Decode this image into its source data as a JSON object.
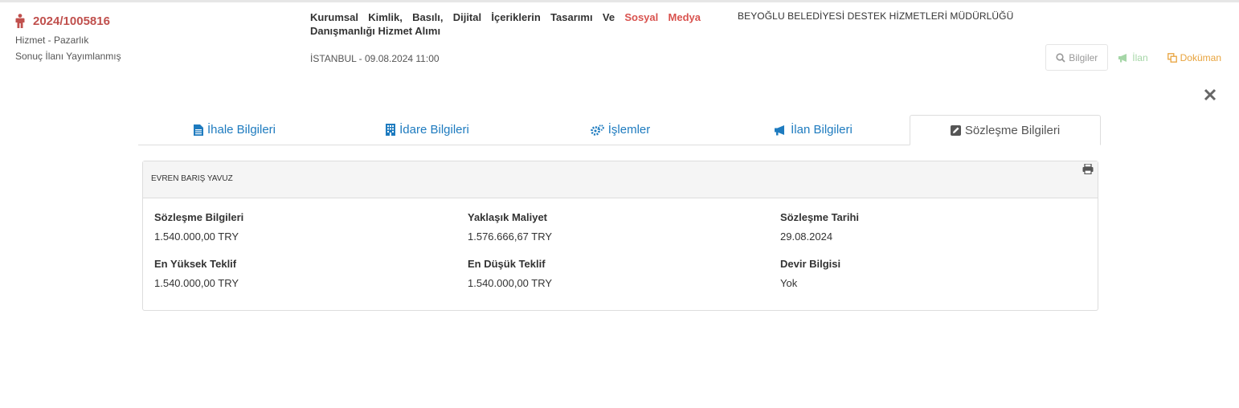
{
  "header": {
    "ref_number": "2024/1005816",
    "type": "Hizmet - Pazarlık",
    "status": "Sonuç İlanı Yayımlanmış",
    "title_main": "Kurumsal Kimlik, Basılı, Dijital İçeriklerin Tasarımı Ve ",
    "title_highlight": "Sosyal Medya",
    "title_rest": " Danışmanlığı Hizmet Alımı",
    "location_date": "İSTANBUL - 09.08.2024 11:00",
    "authority": "BEYOĞLU BELEDİYESİ DESTEK HİZMETLERİ MÜDÜRLÜĞÜ"
  },
  "actions": {
    "info_label": "Bilgiler",
    "ilan_label": "İlan",
    "doc_label": "Doküman"
  },
  "tabs": [
    {
      "label": "İhale Bilgileri",
      "icon": "file-icon"
    },
    {
      "label": "İdare Bilgileri",
      "icon": "building-icon"
    },
    {
      "label": "İşlemler",
      "icon": "cogs-icon"
    },
    {
      "label": "İlan Bilgileri",
      "icon": "bullhorn-icon"
    },
    {
      "label": "Sözleşme Bilgileri",
      "icon": "edit-icon",
      "active": true
    }
  ],
  "contract": {
    "company": "EVREN BARIŞ YAVUZ",
    "fields": [
      {
        "label": "Sözleşme Bilgileri",
        "value": "1.540.000,00 TRY"
      },
      {
        "label": "Yaklaşık Maliyet",
        "value": "1.576.666,67 TRY"
      },
      {
        "label": "Sözleşme Tarihi",
        "value": "29.08.2024"
      },
      {
        "label": "En Yüksek Teklif",
        "value": "1.540.000,00 TRY"
      },
      {
        "label": "En Düşük Teklif",
        "value": "1.540.000,00 TRY"
      },
      {
        "label": "Devir Bilgisi",
        "value": "Yok"
      }
    ]
  },
  "colors": {
    "accent_red": "#c0504d",
    "tab_blue": "#1e7bbf",
    "doc_orange": "#e8a33c",
    "ilan_green": "#a5d6a7"
  }
}
